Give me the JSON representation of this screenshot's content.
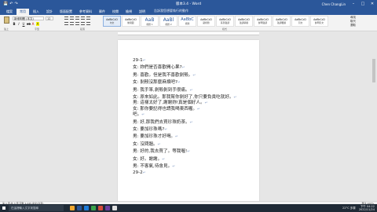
{
  "titlebar": {
    "document_title": "版本3.4 - Word",
    "user": "Chen ChangLin",
    "qat": [
      "save",
      "undo",
      "redo"
    ]
  },
  "tabs": [
    "檔案",
    "常用",
    "插入",
    "設計",
    "版面配置",
    "參考資料",
    "郵件",
    "校閱",
    "檢視",
    "說明"
  ],
  "active_tab": 1,
  "tell_me": "告訴我您想要執行的動作",
  "ribbon": {
    "paste_label": "貼上",
    "font_name": "新細明體 (本文)",
    "font_size": "12",
    "font_group_label": "字型",
    "paragraph_group_label": "段落",
    "styles_group_label": "樣式",
    "editing": [
      "尋找",
      "取代",
      "選取"
    ],
    "editing_group_label": "編輯",
    "styles": [
      {
        "preview": "AaBbCcD",
        "name": "內文",
        "cls": ""
      },
      {
        "preview": "AaBbCcD",
        "name": "無間距",
        "cls": ""
      },
      {
        "preview": "AaB",
        "name": "標題 1",
        "cls": "big"
      },
      {
        "preview": "AaBl",
        "name": "標題 2",
        "cls": "big"
      },
      {
        "preview": "AaBbC",
        "name": "標題",
        "cls": "mid"
      },
      {
        "preview": "AaBbCcD",
        "name": "副標題",
        "cls": ""
      },
      {
        "preview": "AaBbCcD",
        "name": "區別強調",
        "cls": ""
      },
      {
        "preview": "AaBbCcD",
        "name": "強調斜體",
        "cls": ""
      },
      {
        "preview": "AaBbCcD",
        "name": "鮮明強調",
        "cls": ""
      },
      {
        "preview": "AaBbCcD",
        "name": "強調粗體",
        "cls": ""
      },
      {
        "preview": "AaBbCcD",
        "name": "引文",
        "cls": ""
      },
      {
        "preview": "AaBbCcD",
        "name": "鮮明引文",
        "cls": ""
      }
    ]
  },
  "document": {
    "lines": [
      {
        "t": "29-1",
        "gap": false
      },
      {
        "t": "女: 妳們是否喜歡開心果?",
        "gap": true
      },
      {
        "t": "男: 喜歡。但是我不喜歡剝殼。",
        "gap": true
      },
      {
        "t": "女: 剝殼沒那麼麻煩吧?",
        "gap": true
      },
      {
        "t": "男: 我手笨,剝殼剝到手很痛。",
        "gap": true
      },
      {
        "t": "女: 原來如此。那我幫你剝好了,你只要負責吃就好。",
        "gap": true
      },
      {
        "t": "男: 這樣太好了,謝謝妳!真是個好人。",
        "gap": false
      },
      {
        "t": "女: 那你要記得也請我喝東西喔。",
        "gap": false
      },
      {
        "t": "吧。",
        "gap": false
      },
      {
        "t": "男: 好,那我們去買珍珠奶茶。",
        "gap": true
      },
      {
        "t": "女: 要加珍珠嗎?",
        "gap": true
      },
      {
        "t": "男: 要加珍珠才好喝。",
        "gap": true
      },
      {
        "t": "女: 沒問題。",
        "gap": true
      },
      {
        "t": "男: 好的,我去買了。等我喔!",
        "gap": true
      },
      {
        "t": "女: 好。謝謝。",
        "gap": true
      },
      {
        "t": "男: 不客氣,待會見。",
        "gap": true
      },
      {
        "t": "29-2",
        "gap": false
      }
    ]
  },
  "status": {
    "left": "第 1 頁,共 3 頁 字數 1,245 中文(台灣)",
    "right": "專注 100%"
  },
  "taskbar": {
    "search_placeholder": "在這裡輸入文字來搜尋",
    "weather": "22°C 多雲",
    "time": "下午 04:22",
    "date": "2022/11/24",
    "apps": [
      "#f0a830",
      "#2b579a",
      "#1e7bd8",
      "#3aa34a",
      "#d54b3b",
      "#6a3fa0",
      "#e0e0e0"
    ]
  }
}
